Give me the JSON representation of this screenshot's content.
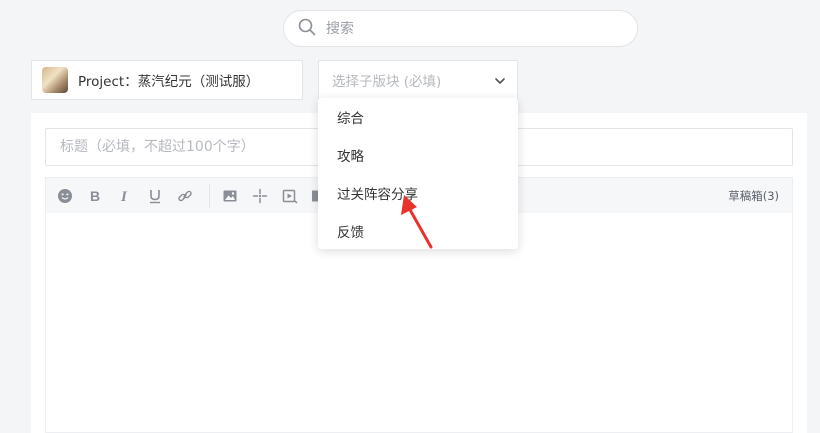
{
  "search": {
    "placeholder": "搜索",
    "icon": "search-icon"
  },
  "project": {
    "label": "Project：蒸汽纪元（测试服）",
    "avatar": "avatar"
  },
  "subforum_select": {
    "placeholder": "选择子版块 (必填)",
    "icon": "chevron-down-icon"
  },
  "dropdown": {
    "options": [
      "综合",
      "攻略",
      "过关阵容分享",
      "反馈"
    ]
  },
  "editor": {
    "title_placeholder": "标题（必填，不超过100个字）",
    "drafts_label": "草稿箱(3)",
    "toolbar_icons": [
      "emoji-icon",
      "bold-icon",
      "italic-icon",
      "underline-icon",
      "link-icon",
      "image-icon",
      "move-icon",
      "video-icon",
      "more-icon"
    ]
  },
  "annotation": {
    "color": "#e8322b"
  }
}
